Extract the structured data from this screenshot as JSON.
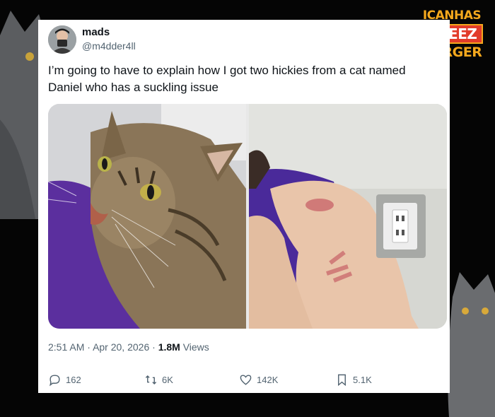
{
  "tweet": {
    "display_name": "mads",
    "handle": "@m4dder4ll",
    "text": "I’m going to have to explain how I got two hickies from a cat named Daniel who has a suckling issue",
    "time": "2:51 AM",
    "separator": "·",
    "date": "Apr 20, 2026",
    "views_count": "1.8M",
    "views_label": "Views"
  },
  "actions": {
    "replies": "162",
    "reposts": "6K",
    "likes": "142K",
    "bookmarks": "5.1K"
  },
  "watermark": {
    "line1": "ICANHAS",
    "line2": "CHEEZ",
    "line3": "BURGER"
  },
  "colors": {
    "text": "#0f1419",
    "muted": "#536471",
    "logo_orange": "#f4a81d",
    "logo_red": "#e23c2a"
  },
  "icons": [
    "reply-icon",
    "repost-icon",
    "like-icon",
    "bookmark-icon"
  ]
}
